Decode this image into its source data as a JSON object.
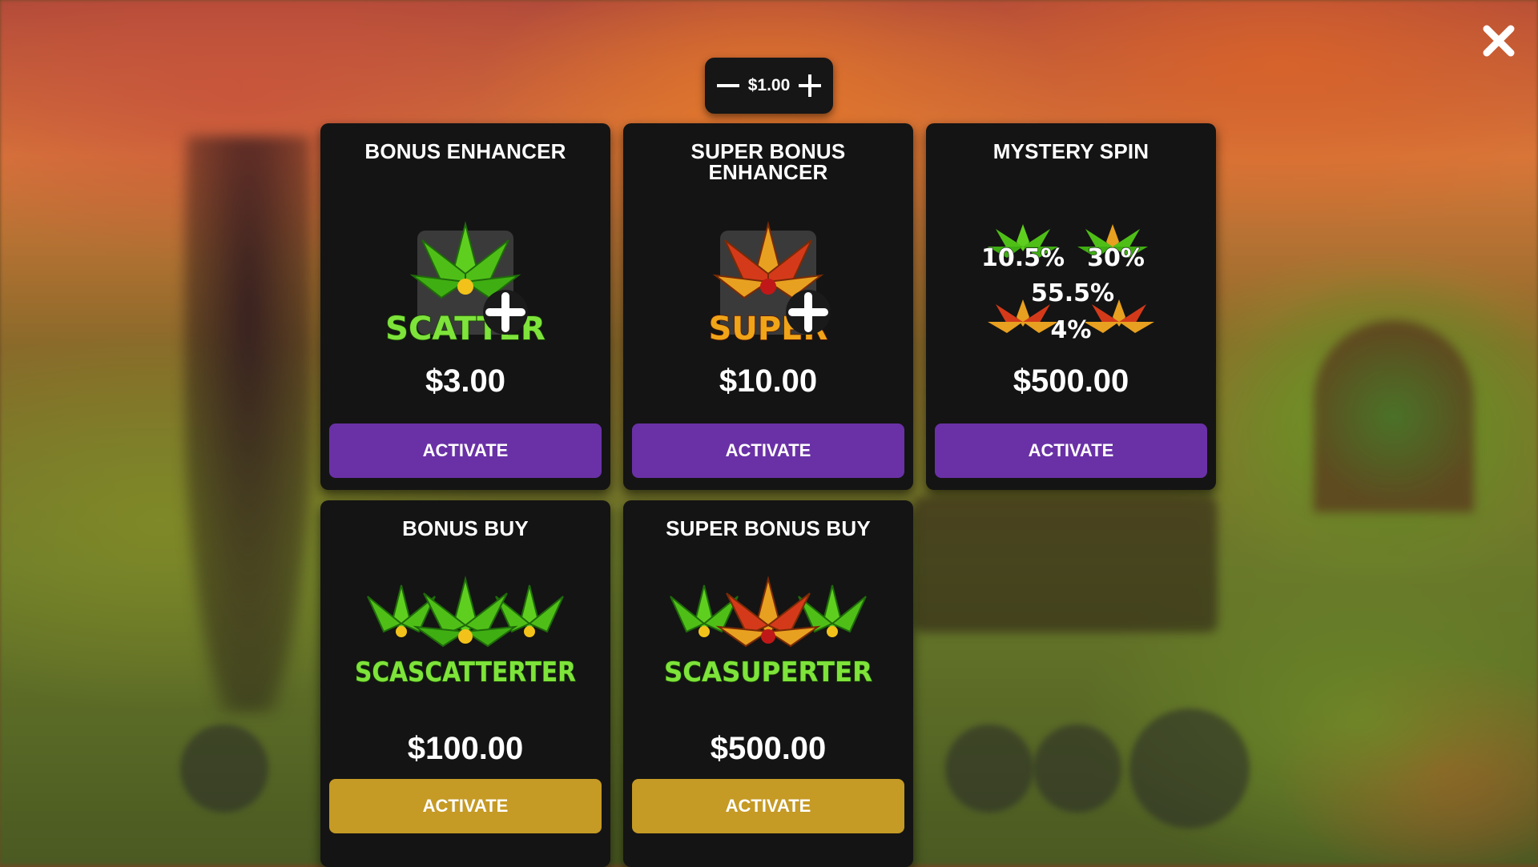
{
  "bet": {
    "value": "$1.00",
    "decrease_icon": "minus-icon",
    "increase_icon": "plus-icon"
  },
  "close_icon": "close-icon",
  "colors": {
    "card_bg": "#141414",
    "activate_purple": "#6a31a6",
    "activate_gold": "#c59a25",
    "text": "#ffffff"
  },
  "features": [
    {
      "title": "BONUS ENHANCER",
      "icon": "scatter-plus-icon",
      "icon_text": "SCATTER",
      "price": "$3.00",
      "button_label": "ACTIVATE",
      "button_color": "purple"
    },
    {
      "title": "SUPER BONUS ENHANCER",
      "icon": "super-plus-icon",
      "icon_text": "SUPER",
      "price": "$10.00",
      "button_label": "ACTIVATE",
      "button_color": "purple"
    },
    {
      "title": "MYSTERY SPIN",
      "icon": "mystery-odds-icon",
      "odds": [
        "10.5%",
        "30%",
        "55.5%",
        "4%"
      ],
      "price": "$500.00",
      "button_label": "ACTIVATE",
      "button_color": "purple"
    },
    {
      "title": "BONUS BUY",
      "icon": "triple-scatter-icon",
      "icon_text": "SCASCATTERTER",
      "price": "$100.00",
      "button_label": "ACTIVATE",
      "button_color": "gold"
    },
    {
      "title": "SUPER BONUS BUY",
      "icon": "scatter-super-scatter-icon",
      "icon_text": "SCASUPERTER",
      "price": "$500.00",
      "button_label": "ACTIVATE",
      "button_color": "gold"
    }
  ]
}
